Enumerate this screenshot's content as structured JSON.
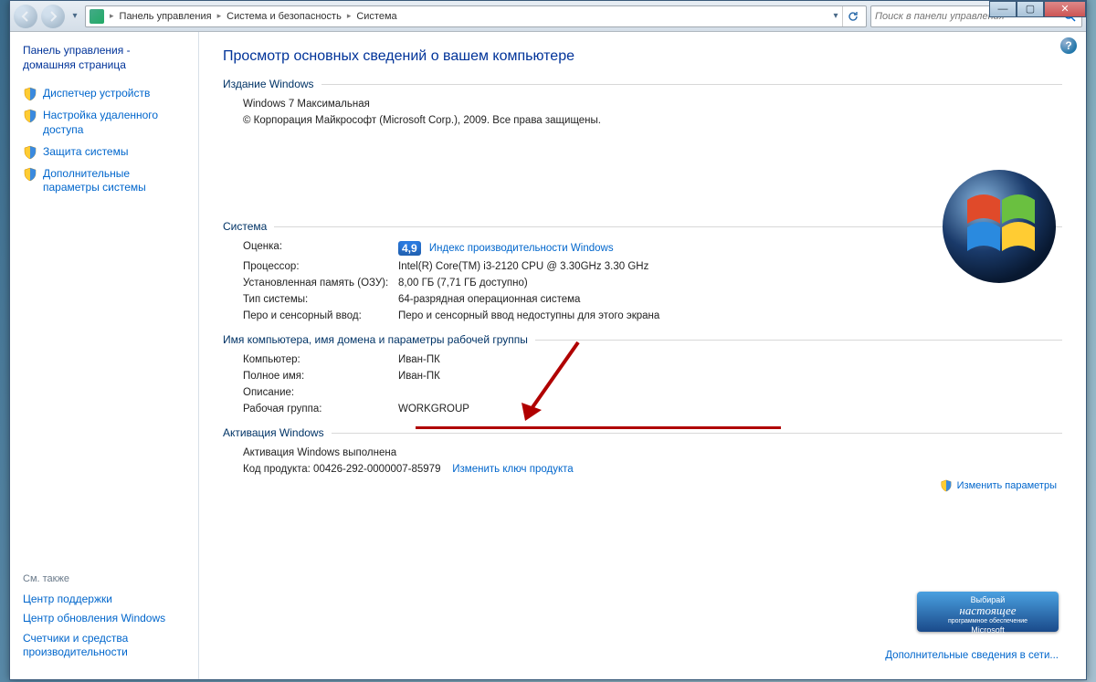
{
  "breadcrumb": {
    "items": [
      "Панель управления",
      "Система и безопасность",
      "Система"
    ]
  },
  "search": {
    "placeholder": "Поиск в панели управления"
  },
  "sidebar": {
    "home": "Панель управления - домашняя страница",
    "links": [
      "Диспетчер устройств",
      "Настройка удаленного доступа",
      "Защита системы",
      "Дополнительные параметры системы"
    ],
    "see_also_label": "См. также",
    "see_also": [
      "Центр поддержки",
      "Центр обновления Windows",
      "Счетчики и средства производительности"
    ]
  },
  "main": {
    "title": "Просмотр основных сведений о вашем компьютере",
    "windows_edition": {
      "legend": "Издание Windows",
      "edition": "Windows 7 Максимальная",
      "copyright": "© Корпорация Майкрософт (Microsoft Corp.), 2009. Все права защищены."
    },
    "system": {
      "legend": "Система",
      "rating_label": "Оценка:",
      "rating_value": "4,9",
      "rating_link": "Индекс производительности Windows",
      "processor_label": "Процессор:",
      "processor_value": "Intel(R) Core(TM) i3-2120 CPU @ 3.30GHz   3.30 GHz",
      "ram_label": "Установленная память (ОЗУ):",
      "ram_value": "8,00 ГБ (7,71 ГБ доступно)",
      "type_label": "Тип системы:",
      "type_value": "64-разрядная операционная система",
      "pen_label": "Перо и сенсорный ввод:",
      "pen_value": "Перо и сенсорный ввод недоступны для этого экрана"
    },
    "computer": {
      "legend": "Имя компьютера, имя домена и параметры рабочей группы",
      "name_label": "Компьютер:",
      "name_value": "Иван-ПК",
      "fullname_label": "Полное имя:",
      "fullname_value": "Иван-ПК",
      "desc_label": "Описание:",
      "desc_value": "",
      "workgroup_label": "Рабочая группа:",
      "workgroup_value": "WORKGROUP",
      "change_link": "Изменить параметры"
    },
    "activation": {
      "legend": "Активация Windows",
      "status": "Активация Windows выполнена",
      "product_key_label": "Код продукта: 00426-292-0000007-85979",
      "change_key_link": "Изменить ключ продукта"
    },
    "genuine": {
      "line1": "Выбирай",
      "line2": "настоящее",
      "line3": "программное обеспечение",
      "line4": "Microsoft"
    },
    "more_info": "Дополнительные сведения в сети..."
  }
}
